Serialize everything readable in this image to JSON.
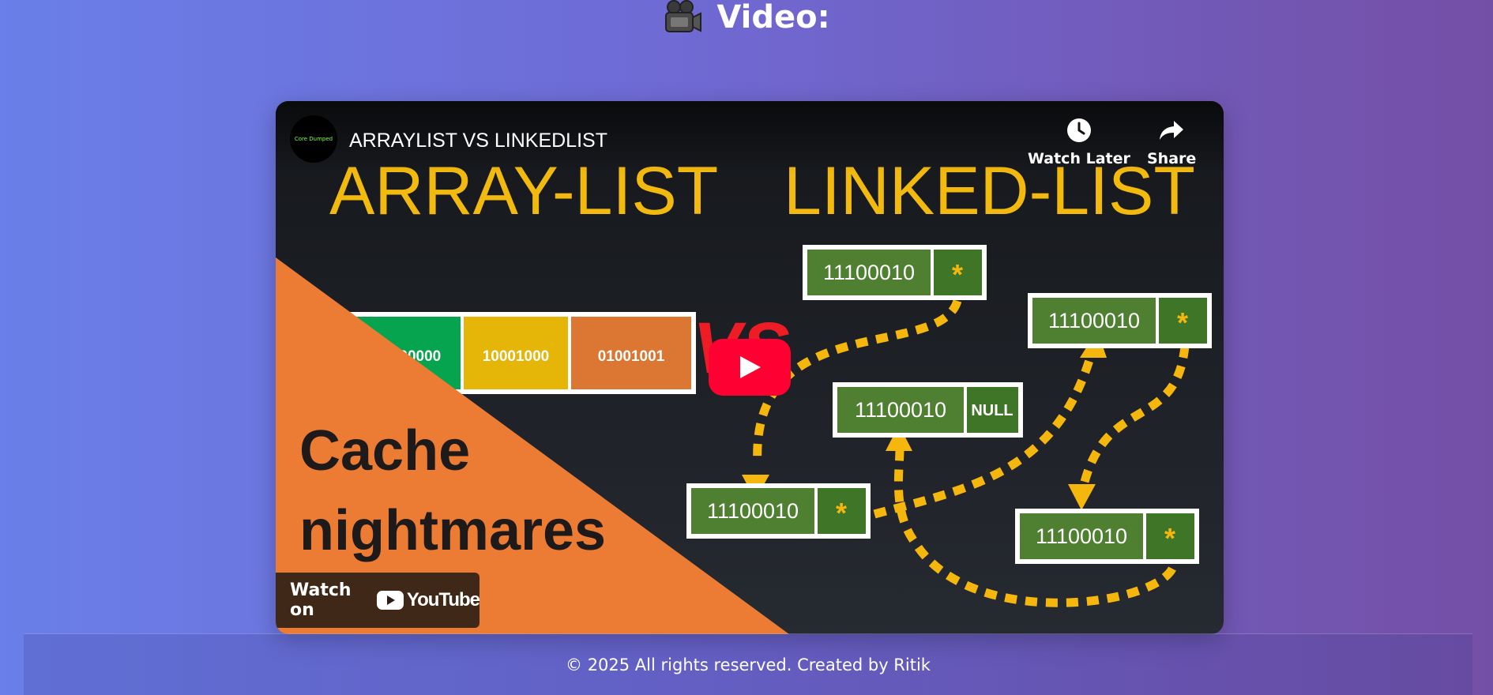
{
  "section": {
    "title": "Video:",
    "icon": "movie-camera-icon"
  },
  "video": {
    "title": "ARRAYLIST VS LINKEDLIST",
    "channel_avatar_text": "Core Dumped",
    "controls": {
      "watch_later": "Watch Later",
      "share": "Share"
    },
    "watch_on": {
      "label": "Watch on",
      "brand": "YouTube"
    },
    "thumbnail": {
      "heading_left": "ARRAY-LIST",
      "heading_right": "LINKED-LIST",
      "vs": "VS",
      "array_cells": [
        "00000000",
        "10001000",
        "01001001"
      ],
      "caption_line1": "Cache",
      "caption_line2": "nightmares",
      "node_value": "11100010",
      "pointer_symbol": "*",
      "null_label": "NULL"
    }
  },
  "footer": {
    "text": "© 2025 All rights reserved. Created by Ritik"
  }
}
